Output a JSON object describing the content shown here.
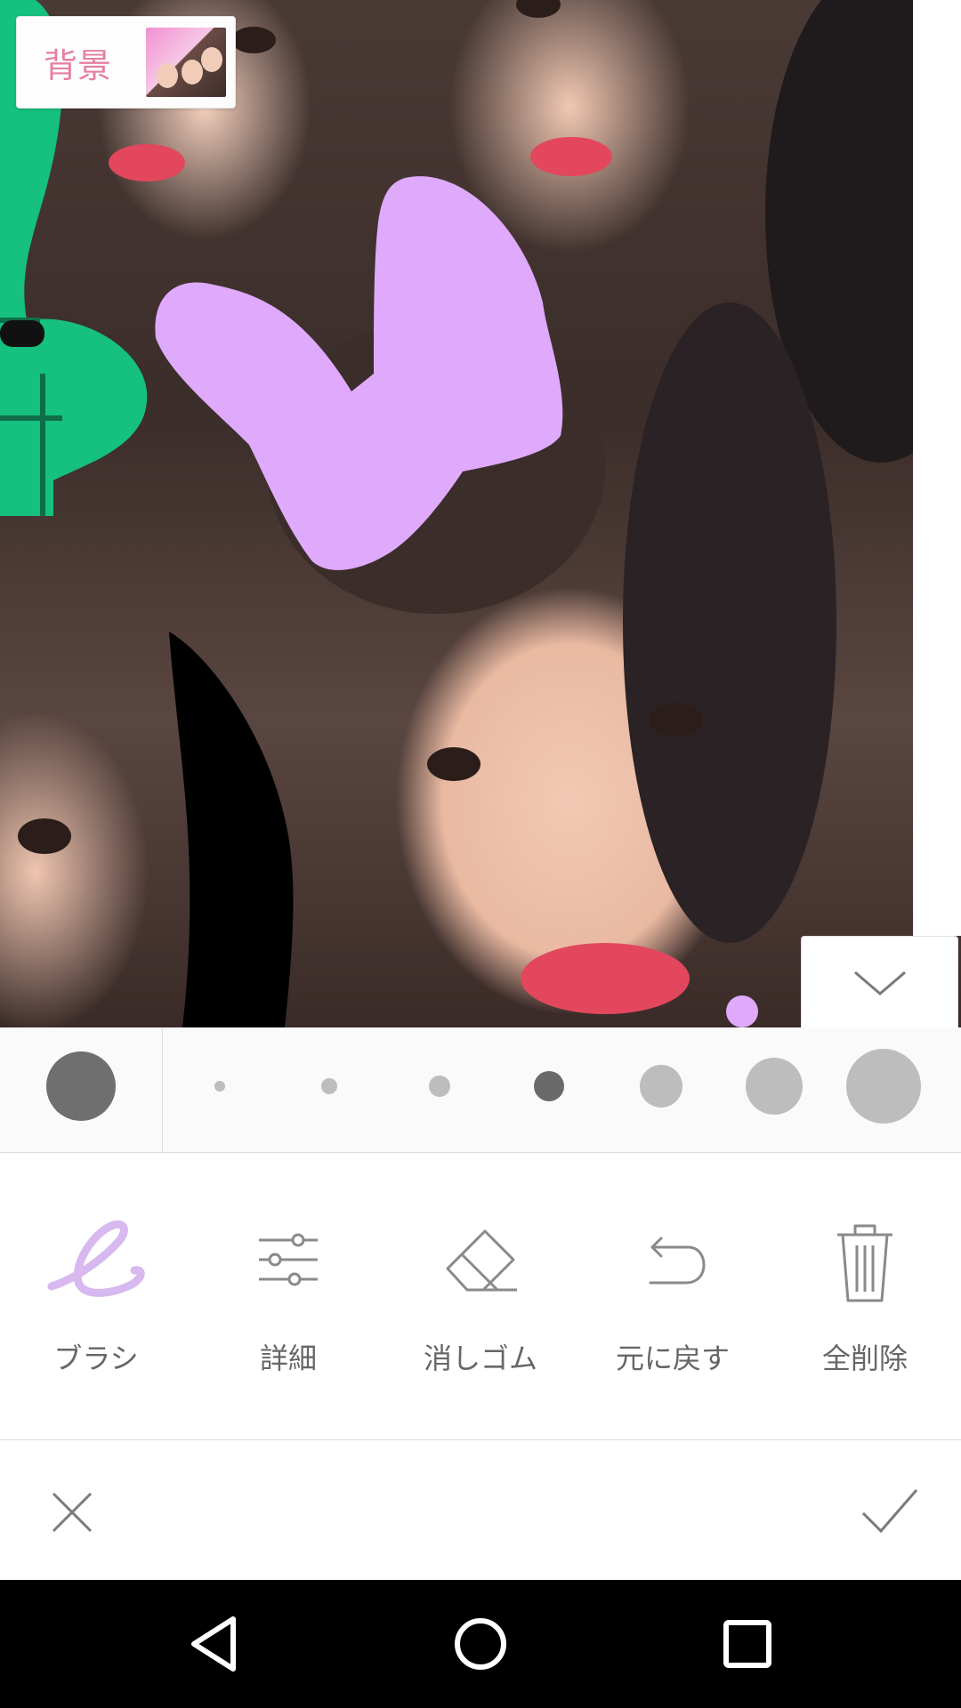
{
  "background_chip": {
    "label": "背景"
  },
  "brush_sizes": {
    "count": 7,
    "selected_index": 3
  },
  "colors": {
    "brush_accent": "#d7b8ef",
    "label_pink": "#e67fa1",
    "drawing_lilac": "#dfaafc",
    "drawing_green": "#16c07f",
    "swatch_current": "#6f6f6f"
  },
  "tools": [
    {
      "label": "ブラシ",
      "icon": "brush-icon"
    },
    {
      "label": "詳細",
      "icon": "sliders-icon"
    },
    {
      "label": "消しゴム",
      "icon": "eraser-icon"
    },
    {
      "label": "元に戻す",
      "icon": "undo-icon"
    },
    {
      "label": "全削除",
      "icon": "trash-icon"
    }
  ],
  "confirm": {
    "cancel_icon": "close-icon",
    "ok_icon": "check-icon"
  },
  "navigation": [
    "back-icon",
    "home-icon",
    "recents-icon"
  ]
}
